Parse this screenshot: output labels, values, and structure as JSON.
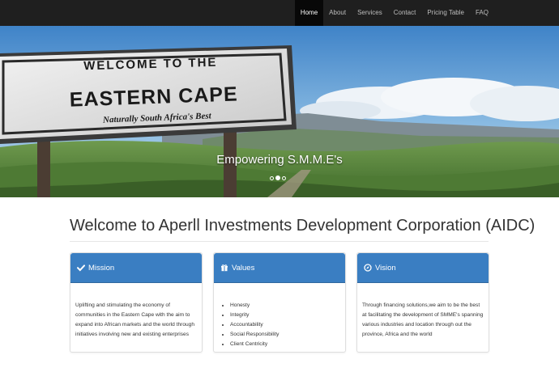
{
  "navbar": {
    "links": [
      {
        "label": "Home",
        "active": true
      },
      {
        "label": "About",
        "active": false
      },
      {
        "label": "Services",
        "active": false
      },
      {
        "label": "Contact",
        "active": false
      },
      {
        "label": "Pricing Table",
        "active": false
      },
      {
        "label": "FAQ",
        "active": false
      }
    ]
  },
  "hero": {
    "sign": {
      "line1": "WELCOME TO THE",
      "line2": "EASTERN CAPE",
      "line3": "Naturally South Africa's Best"
    },
    "caption": "Empowering S.M.M.E's",
    "slide_count": 3,
    "active_slide": 2
  },
  "main": {
    "title": "Welcome to Aperll Investments Development Corporation (AIDC)",
    "panels": [
      {
        "icon": "checkmark-icon",
        "heading": "Mission",
        "text": "Uplifting and stimulating the economy of communities in the Eastern Cape with the aim to expand into African markets and the world through initiatives involving new and existing enterprises"
      },
      {
        "icon": "gift-icon",
        "heading": "Values",
        "items": [
          "Honesty",
          "Integrity",
          "Accountability",
          "Social Responsibility",
          "Client Centricity"
        ]
      },
      {
        "icon": "compass-icon",
        "heading": "Vision",
        "text": "Through financing solutions,we aim to be the best at facilitating the development of SMME's spanning various industries and location through out the province, Africa and the world"
      }
    ]
  },
  "colors": {
    "navbar_bg": "#1f1f1f",
    "panel_heading": "#3a7ec2"
  }
}
